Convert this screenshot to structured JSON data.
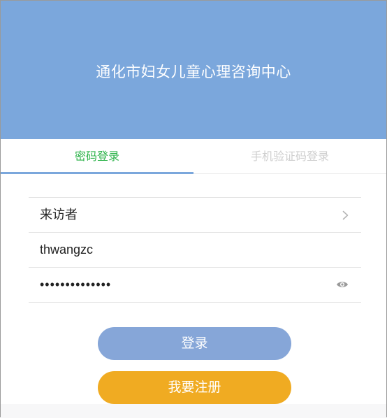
{
  "header": {
    "title": "通化市妇女儿童心理咨询中心"
  },
  "tabs": [
    {
      "label": "密码登录",
      "active": true
    },
    {
      "label": "手机验证码登录",
      "active": false
    }
  ],
  "form": {
    "role_value": "来访者",
    "username_value": "thwangzc",
    "password_value": "••••••••••••••"
  },
  "buttons": {
    "login_label": "登录",
    "register_label": "我要注册"
  },
  "colors": {
    "header_bg": "#7ba7dc",
    "active_tab_text": "#2db34a",
    "inactive_tab_text": "#cfcfcf",
    "login_button_bg": "#86a6d8",
    "register_button_bg": "#f0ab22"
  },
  "icons": {
    "role_chevron": "chevron-right-icon",
    "password_toggle": "eye-icon"
  }
}
